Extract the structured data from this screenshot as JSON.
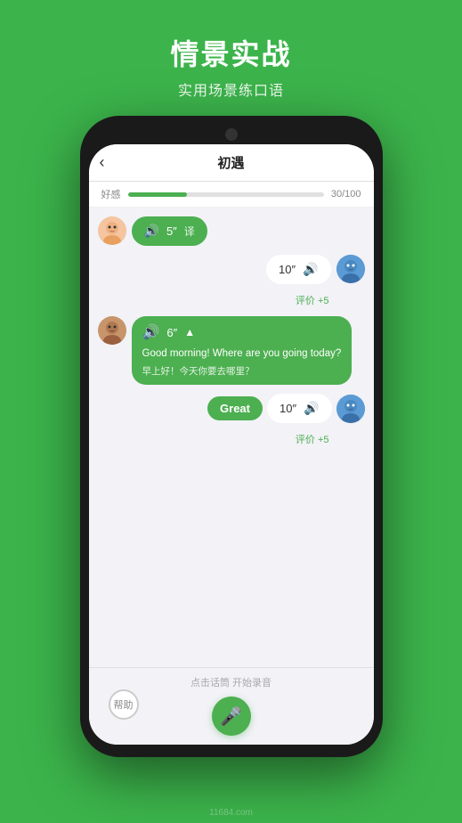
{
  "background_color": "#3cb44b",
  "top": {
    "title": "情景实战",
    "subtitle": "实用场景练口语"
  },
  "phone": {
    "header": {
      "back_icon": "‹",
      "title": "初遇"
    },
    "progress": {
      "label": "好感",
      "value": "30/100",
      "percent": 30
    },
    "messages": [
      {
        "side": "left",
        "avatar": "female1",
        "type": "audio",
        "duration": "5″",
        "has_translate": true,
        "translate_label": "译"
      },
      {
        "side": "right",
        "avatar": "male",
        "type": "audio",
        "duration": "10″"
      },
      {
        "side": "right",
        "score": "评价 +5"
      },
      {
        "side": "left",
        "avatar": "female2",
        "type": "audio_expanded",
        "duration": "6″",
        "text_en": "Good morning! Where are you going today?",
        "text_cn": "早上好！今天你要去哪里？"
      },
      {
        "side": "right_combo",
        "great_label": "Great",
        "avatar": "male",
        "duration": "10″"
      },
      {
        "side": "right",
        "score": "评价 +5"
      }
    ],
    "footer": {
      "hint": "点击话筒 开始录音",
      "mic_icon": "🎤",
      "help_label": "帮助"
    }
  },
  "watermark": "11684.com"
}
